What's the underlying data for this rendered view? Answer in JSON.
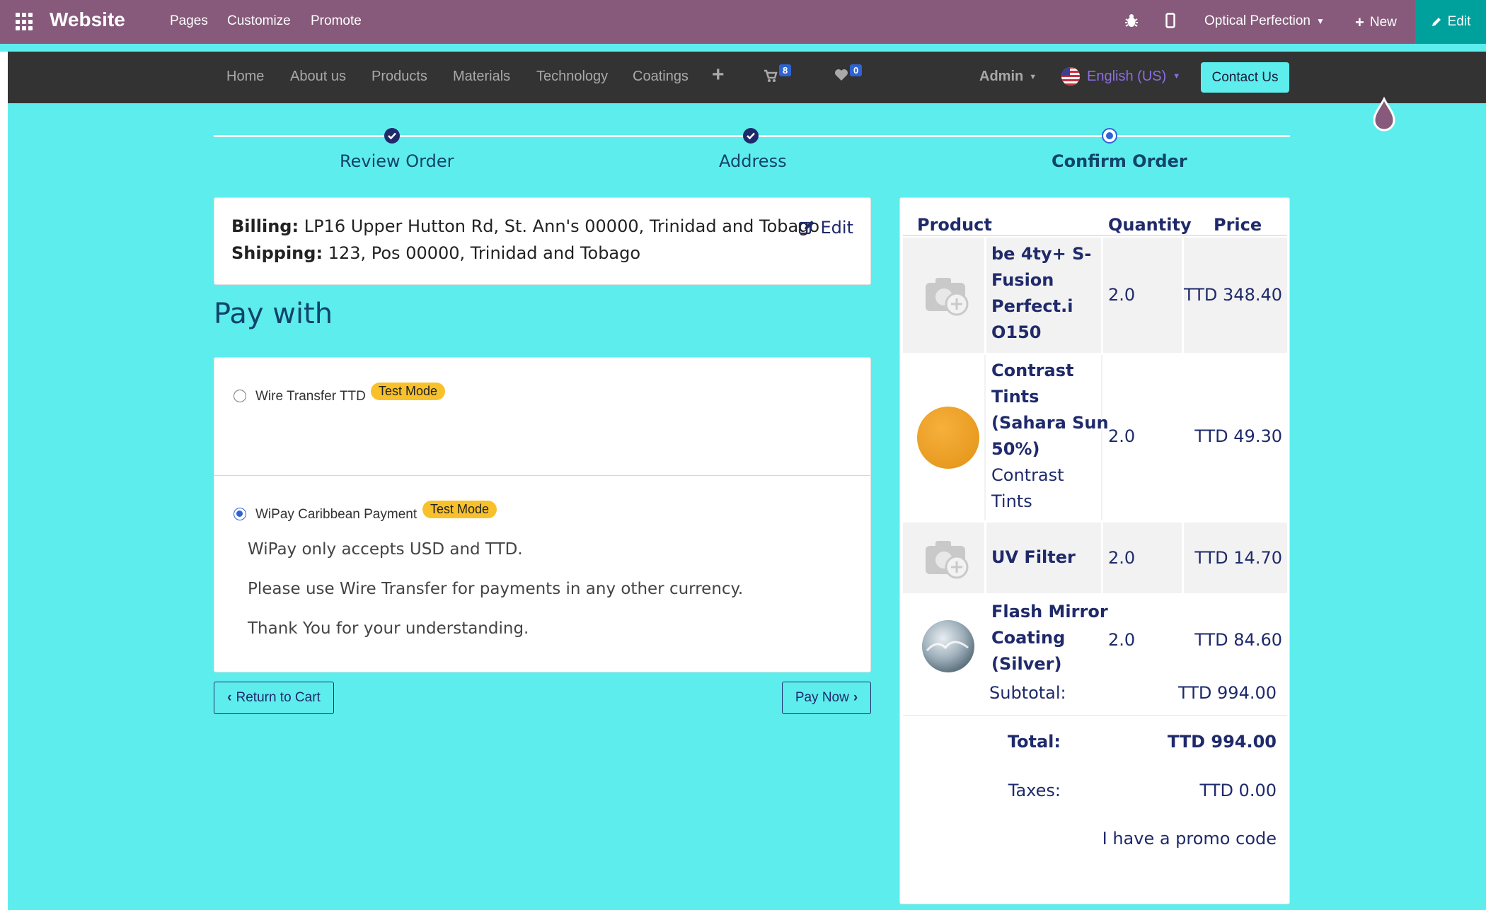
{
  "topbar": {
    "brand": "Website",
    "menu": [
      "Pages",
      "Customize",
      "Promote"
    ],
    "company": "Optical Perfection",
    "new_label": "New",
    "edit_label": "Edit"
  },
  "nav": {
    "items": [
      "Home",
      "About us",
      "Products",
      "Materials",
      "Technology",
      "Coatings"
    ],
    "cart_count": "8",
    "wishlist_count": "0",
    "user": "Admin",
    "language": "English (US)",
    "contact": "Contact Us"
  },
  "steps": [
    {
      "label": "Review Order",
      "state": "done"
    },
    {
      "label": "Address",
      "state": "done"
    },
    {
      "label": "Confirm Order",
      "state": "current"
    }
  ],
  "address": {
    "billing_label": "Billing:",
    "billing": "LP16 Upper Hutton Rd, St. Ann's 00000, Trinidad and Tobago",
    "shipping_label": "Shipping:",
    "shipping": "123, Pos 00000, Trinidad and Tobago",
    "edit": "Edit"
  },
  "pay_with_title": "Pay with",
  "payment_methods": [
    {
      "name": "Wire Transfer TTD",
      "badge": "Test Mode",
      "selected": false
    },
    {
      "name": "WiPay Caribbean Payment",
      "badge": "Test Mode",
      "selected": true,
      "description": [
        "WiPay only accepts USD and TTD.",
        "Please use Wire Transfer for payments in any other currency.",
        "Thank You for your understanding."
      ]
    }
  ],
  "buttons": {
    "return": "Return to Cart",
    "pay": "Pay Now"
  },
  "summary": {
    "headers": {
      "product": "Product",
      "quantity": "Quantity",
      "price": "Price"
    },
    "lines": [
      {
        "name_lines": [
          "be 4ty+ S-",
          "Fusion",
          "Perfect.i",
          "O150"
        ],
        "qty": "2.0",
        "price": "TTD 348.40",
        "image": "placeholder-camera"
      },
      {
        "name_lines": [
          "Contrast",
          "Tints",
          "(Sahara Sun",
          "50%)"
        ],
        "sub_lines": [
          "Contrast",
          "Tints"
        ],
        "qty": "2.0",
        "price": "TTD 49.30",
        "image": "orange-sphere"
      },
      {
        "name_lines": [
          "UV Filter"
        ],
        "qty": "2.0",
        "price": "TTD 14.70",
        "image": "placeholder-camera"
      },
      {
        "name_lines": [
          "Flash Mirror",
          "Coating",
          "(Silver)"
        ],
        "qty": "2.0",
        "price": "TTD 84.60",
        "image": "silver-sphere"
      }
    ],
    "subtotal_label": "Subtotal:",
    "subtotal": "TTD 994.00",
    "total_label": "Total:",
    "total": "TTD 994.00",
    "taxes_label": "Taxes:",
    "taxes": "TTD 0.00",
    "promo": "I have a promo code"
  },
  "colors": {
    "odoo_bar": "#875a7b",
    "site_bg": "#5eeded",
    "accent": "#1f2a6b",
    "badge": "#f8c12c"
  }
}
